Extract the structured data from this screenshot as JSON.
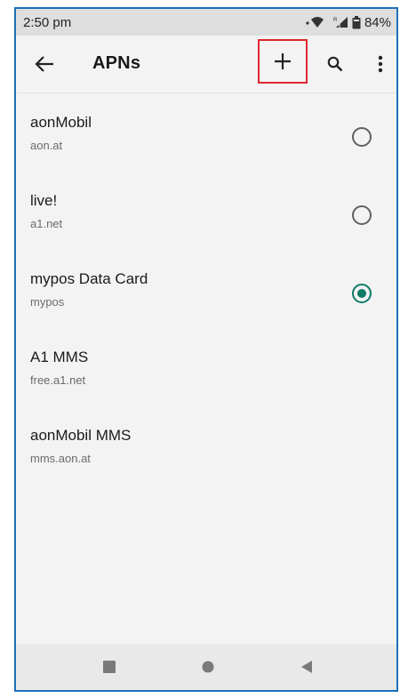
{
  "status_bar": {
    "time": "2:50 pm",
    "battery": "84%",
    "icons": [
      "wifi-icon",
      "signal-icon",
      "battery-icon"
    ]
  },
  "app_bar": {
    "title": "APNs",
    "actions": [
      "back-arrow-icon",
      "add-icon",
      "search-icon",
      "more-vert-icon"
    ]
  },
  "apns": [
    {
      "name": "aonMobil",
      "apn": "aon.at",
      "selectable": true,
      "selected": false
    },
    {
      "name": "live!",
      "apn": "a1.net",
      "selectable": true,
      "selected": false
    },
    {
      "name": "mypos Data Card",
      "apn": "mypos",
      "selectable": true,
      "selected": true
    },
    {
      "name": "A1 MMS",
      "apn": "free.a1.net",
      "selectable": false,
      "selected": false
    },
    {
      "name": "aonMobil MMS",
      "apn": "mms.aon.at",
      "selectable": false,
      "selected": false
    }
  ],
  "nav_bar": {
    "buttons": [
      "recents-square-icon",
      "home-circle-icon",
      "back-triangle-icon"
    ]
  },
  "colors": {
    "accent": "#0f7a68",
    "highlight_box": "#e0262e",
    "frame_border": "#1d6fb8"
  }
}
